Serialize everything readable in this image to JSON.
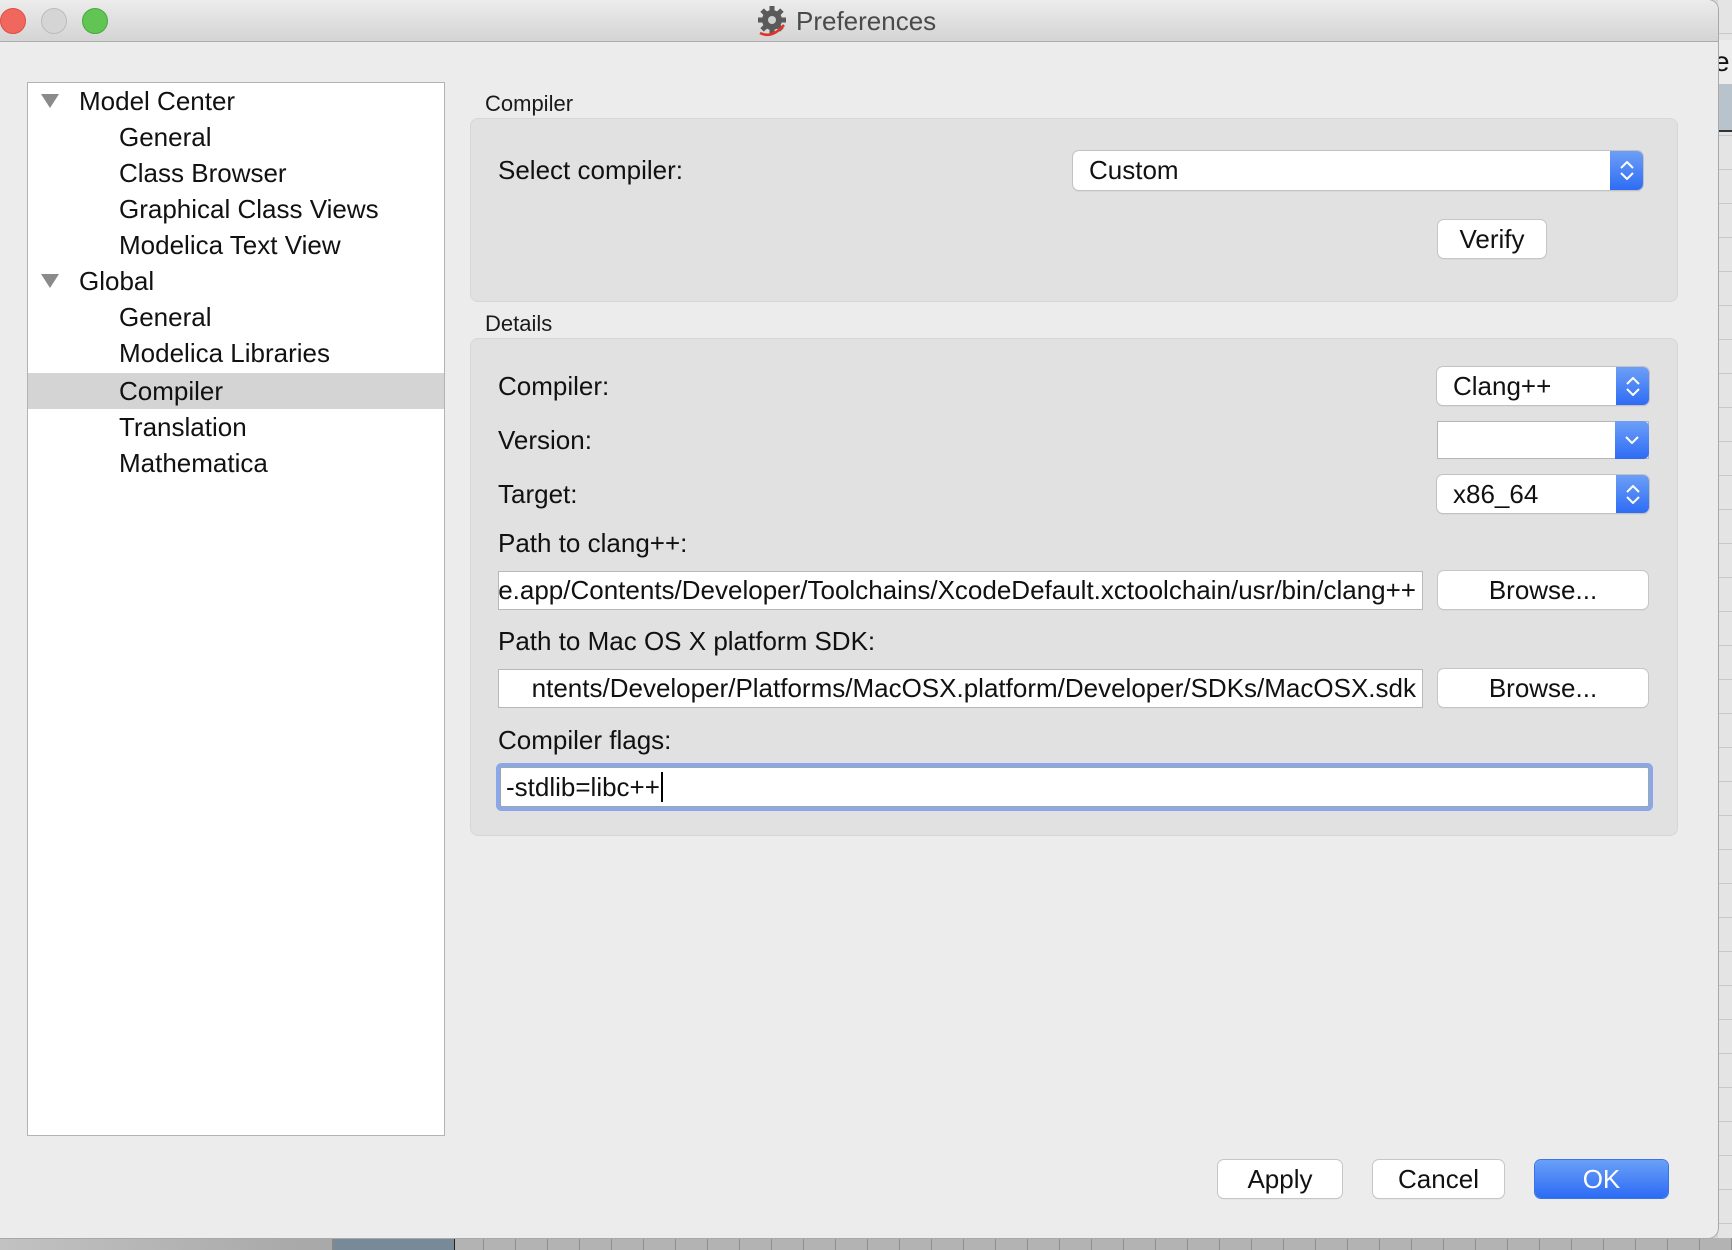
{
  "window": {
    "title": "Preferences",
    "icon": "gear-icon"
  },
  "background_app": {
    "visible_text": "e"
  },
  "tree": {
    "items": [
      {
        "label": "Model Center",
        "level": 0,
        "expanded": true
      },
      {
        "label": "General",
        "level": 1
      },
      {
        "label": "Class Browser",
        "level": 1
      },
      {
        "label": "Graphical Class Views",
        "level": 1
      },
      {
        "label": "Modelica Text View",
        "level": 1
      },
      {
        "label": "Global",
        "level": 0,
        "expanded": true
      },
      {
        "label": "General",
        "level": 1
      },
      {
        "label": "Modelica Libraries",
        "level": 1
      },
      {
        "label": "Compiler",
        "level": 1,
        "selected": true
      },
      {
        "label": "Translation",
        "level": 1
      },
      {
        "label": "Mathematica",
        "level": 1
      }
    ]
  },
  "compiler_group": {
    "title": "Compiler",
    "select_label": "Select compiler:",
    "select_value": "Custom",
    "verify_label": "Verify"
  },
  "details_group": {
    "title": "Details",
    "compiler_label": "Compiler:",
    "compiler_value": "Clang++",
    "version_label": "Version:",
    "version_value": "",
    "target_label": "Target:",
    "target_value": "x86_64",
    "clang_path_label": "Path to clang++:",
    "clang_path_value": "/Applications/Xcode.app/Contents/Developer/Toolchains/XcodeDefault.xctoolchain/usr/bin/clang++",
    "clang_path_visible": "̧/Contents/Developer/Toolchains/XcodeDefault.xctoolchain/usr/bin/clang++",
    "sdk_path_label": "Path to Mac OS X platform SDK:",
    "sdk_path_visible": "ntents/Developer/Platforms/MacOSX.platform/Developer/SDKs/MacOSX.sdk",
    "browse_label": "Browse...",
    "flags_label": "Compiler flags:",
    "flags_value": "-stdlib=libc++"
  },
  "footer": {
    "apply_label": "Apply",
    "cancel_label": "Cancel",
    "ok_label": "OK"
  },
  "colors": {
    "accent": "#2e6cf5",
    "focus_ring": "#8ba7e7",
    "selected_row": "#d4d4d4"
  }
}
